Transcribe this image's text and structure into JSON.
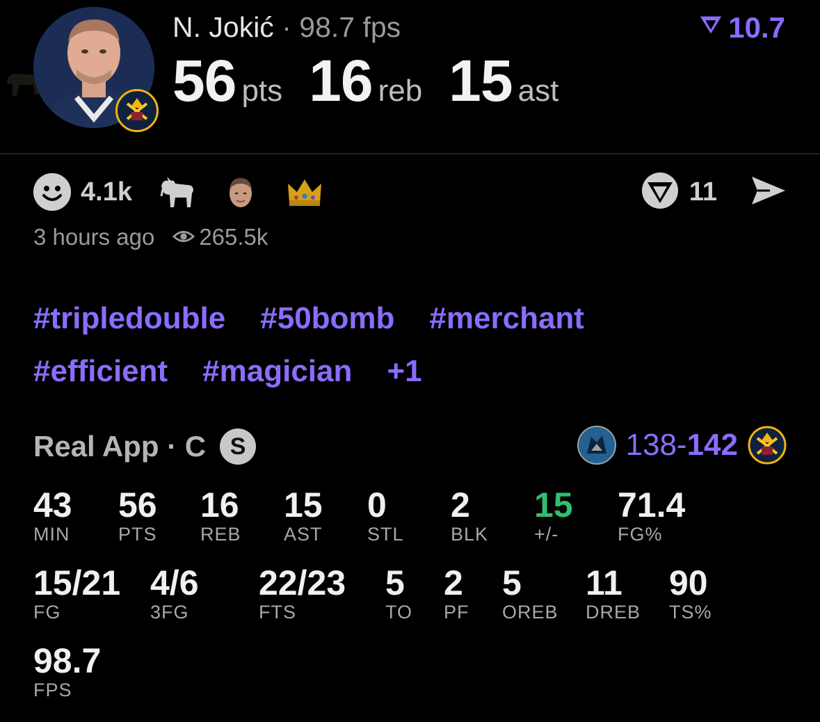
{
  "header": {
    "player_name": "N. Jokić",
    "separator": "·",
    "fps_text": "98.7 fps",
    "rating_value": "10.7",
    "stat_big": [
      {
        "value": "56",
        "unit": "pts"
      },
      {
        "value": "16",
        "unit": "reb"
      },
      {
        "value": "15",
        "unit": "ast"
      }
    ]
  },
  "reactions": {
    "smile_count": "4.1k",
    "emojis": [
      "goat-icon",
      "player-face-icon",
      "crown-icon"
    ],
    "comment_count": "11"
  },
  "meta": {
    "time_ago": "3 hours ago",
    "views": "265.5k"
  },
  "tags": {
    "row1": [
      "#tripledouble",
      "#50bomb",
      "#merchant"
    ],
    "row2": [
      "#efficient",
      "#magician",
      "+1"
    ]
  },
  "game": {
    "source": "Real App · C",
    "badge": "S",
    "score_loser": "138",
    "score_dash": "-",
    "score_winner": "142"
  },
  "stats": {
    "row1": [
      {
        "value": "43",
        "label": "MIN"
      },
      {
        "value": "56",
        "label": "PTS"
      },
      {
        "value": "16",
        "label": "REB"
      },
      {
        "value": "15",
        "label": "AST"
      },
      {
        "value": "0",
        "label": "STL"
      },
      {
        "value": "2",
        "label": "BLK"
      },
      {
        "value": "15",
        "label": "+/-"
      },
      {
        "value": "71.4",
        "label": "FG%"
      }
    ],
    "row2": [
      {
        "value": "15/21",
        "label": "FG"
      },
      {
        "value": "4/6",
        "label": "3FG"
      },
      {
        "value": "22/23",
        "label": "FTS"
      },
      {
        "value": "5",
        "label": "TO"
      },
      {
        "value": "2",
        "label": "PF"
      },
      {
        "value": "5",
        "label": "OREB"
      },
      {
        "value": "11",
        "label": "DREB"
      },
      {
        "value": "90",
        "label": "TS%"
      }
    ],
    "row3": [
      {
        "value": "98.7",
        "label": "FPS"
      }
    ]
  },
  "colors": {
    "accent": "#8b6cff",
    "positive": "#2fbf71",
    "background": "#000000"
  }
}
